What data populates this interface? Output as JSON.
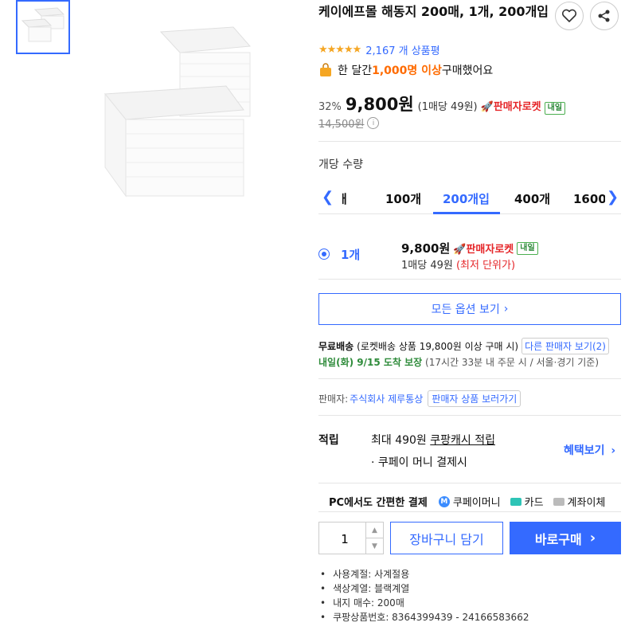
{
  "product": {
    "title": "케이에프몰 해동지 200매, 1개, 200개입",
    "review_count": "2,167 개 상품평",
    "purchase_prefix": "한 달간 ",
    "purchase_highlight": "1,000명 이상",
    "purchase_suffix": " 구매했어요",
    "discount": "32%",
    "price": "9,800원",
    "unit_price": "(1매당 49원)",
    "rocket_label": "판매자로켓",
    "badge": "내일",
    "original_price": "14,500원"
  },
  "quantity": {
    "label": "개당 수량",
    "tabs": [
      "개",
      "100개",
      "200개입",
      "400개",
      "1600개"
    ],
    "active_tab": "200개입"
  },
  "option": {
    "name": "1개",
    "price": "9,800원",
    "rocket_label": "판매자로켓",
    "badge": "내일",
    "unit_prefix": "1매당 49원 ",
    "unit_note": "(최저 단위가)"
  },
  "all_options_label": "모든 옵션 보기",
  "shipping": {
    "free_label": "무료배송",
    "condition": "(로켓배송 상품 19,800원 이상 구매 시)",
    "other_seller": "다른 판매자 보기(2)",
    "arrival": "내일(화) 9/15 도착 보장",
    "arrival_note": " (17시간 33분 내 주문 시 / 서울⋅경기 기준)"
  },
  "seller": {
    "label": "판매자: ",
    "name": "주식회사 제루통상",
    "view_button": "판매자 상품 보러가기"
  },
  "reward": {
    "label": "적립",
    "max": "최대 490원 ",
    "cash": "쿠팡캐시 적립",
    "note": "· 쿠페이 머니 결제시",
    "benefit": "혜택보기"
  },
  "payment": {
    "title": "PC에서도 간편한 결제",
    "coupay": "쿠페이머니",
    "card": "카드",
    "bank": "계좌이체"
  },
  "purchase": {
    "qty": "1",
    "cart": "장바구니 담기",
    "buy": "바로구매"
  },
  "specs": [
    "사용계절: 사계절용",
    "색상계열: 블랙계열",
    "내지 매수: 200매",
    "쿠팡상품번호: 8364399439 - 24166583662"
  ],
  "colors": {
    "accent": "#346aff",
    "rocket": "#e52528",
    "highlight": "#ff6b00",
    "green": "#2e8b3a"
  },
  "rating": {
    "stars": 5
  }
}
